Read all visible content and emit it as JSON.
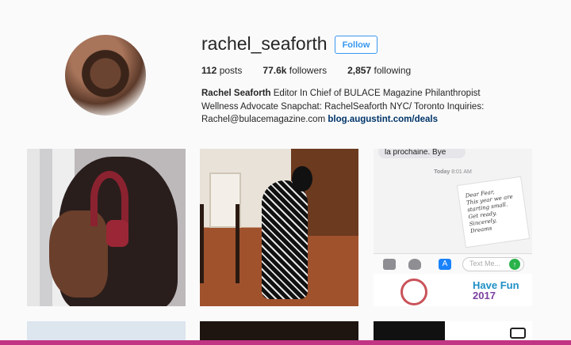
{
  "profile": {
    "username": "rachel_seaforth",
    "follow_label": "Follow",
    "posts_count": "112",
    "posts_label": "posts",
    "followers_count": "77.6k",
    "followers_label": "followers",
    "following_count": "2,857",
    "following_label": "following",
    "full_name": "Rachel Seaforth",
    "bio": "Editor In Chief of BULACE Magazine Philanthropist Wellness Advocate Snapchat: RachelSeaforth NYC/ Toronto Inquiries: Rachel@bulacemagazine.com",
    "link": "blog.augustint.com/deals"
  },
  "grid": {
    "post3": {
      "message_top": "la prochaine. Bye",
      "time_day": "Today",
      "time_clock": "8:01 AM",
      "card_lines": [
        "Dear Fear,",
        "This year we are",
        "starting small.",
        "Get ready.",
        "Sincerely,",
        "Dreams"
      ],
      "input_placeholder": "Text Me...",
      "sticker_text_1": "Have Fun",
      "sticker_text_2": "2017"
    }
  },
  "colors": {
    "accent": "#3897f0",
    "link": "#003569",
    "bottom_bar": "#c13584"
  },
  "icons": [
    "camera-icon",
    "heart-icon",
    "appstore-icon",
    "send-icon",
    "video-icon"
  ]
}
